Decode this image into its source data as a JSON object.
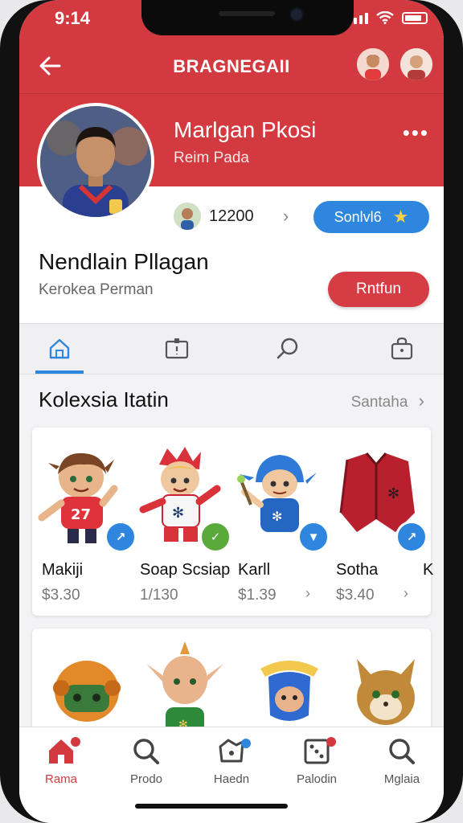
{
  "status": {
    "time": "9:14"
  },
  "header": {
    "brand": "BRAGNEGAII"
  },
  "profile": {
    "name": "Marlgan Pkosi",
    "subtitle": "Reim Pada",
    "follow_count": "12200",
    "blue_button": "Sonlvl6",
    "user_name": "Nendlain Pllagan",
    "user_subtitle": "Kerokea Perman",
    "red_button": "Rntfun"
  },
  "section": {
    "title": "Kolexsia Itatin",
    "see_all": "Santaha"
  },
  "items": [
    {
      "name": "Makiji",
      "price": "$3.30",
      "color": "#2e86de"
    },
    {
      "name": "Soap Scsiap",
      "price": "1/130",
      "color": "#59a93b"
    },
    {
      "name": "Karll",
      "price": "$1.39",
      "color": "#2e86de"
    },
    {
      "name": "Sotha",
      "price": "$3.40",
      "color": "#2e86de"
    }
  ],
  "peek": "K",
  "bottom_nav": [
    {
      "label": "Rama",
      "active": true
    },
    {
      "label": "Prodo",
      "active": false
    },
    {
      "label": "Haedn",
      "active": false
    },
    {
      "label": "Palodin",
      "active": false
    },
    {
      "label": "Mglaia",
      "active": false
    }
  ],
  "colors": {
    "primary_red": "#d33a40",
    "accent_blue": "#2e86de",
    "star_yellow": "#ffd23d"
  }
}
